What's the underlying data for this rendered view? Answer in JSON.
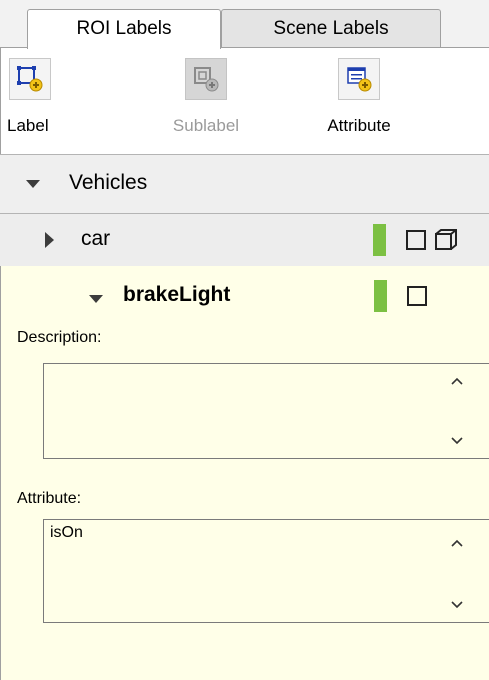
{
  "tabs": [
    {
      "label": "ROI Labels",
      "active": true
    },
    {
      "label": "Scene Labels",
      "active": false
    }
  ],
  "toolbar": {
    "label_button": "Label",
    "sublabel_button": "Sublabel",
    "attribute_button": "Attribute",
    "sublabel_enabled": false
  },
  "tree": {
    "group_name": "Vehicles",
    "labels": [
      {
        "name": "car",
        "expanded": false,
        "color": "#7cc043",
        "shapes": [
          "rectangle-icon",
          "cuboid-icon"
        ]
      },
      {
        "name": "brakeLight",
        "expanded": true,
        "color": "#7cc043",
        "shapes": [
          "rectangle-icon"
        ]
      }
    ]
  },
  "details": {
    "description_label": "Description:",
    "description_value": "",
    "attribute_label": "Attribute:",
    "attribute_value": "isOn"
  },
  "colors": {
    "label_color": "#7cc043",
    "selected_row_bg": "#ffffe8",
    "toolbar_icon_blue": "#1e3faf",
    "toolbar_icon_yellow": "#f2c318"
  }
}
